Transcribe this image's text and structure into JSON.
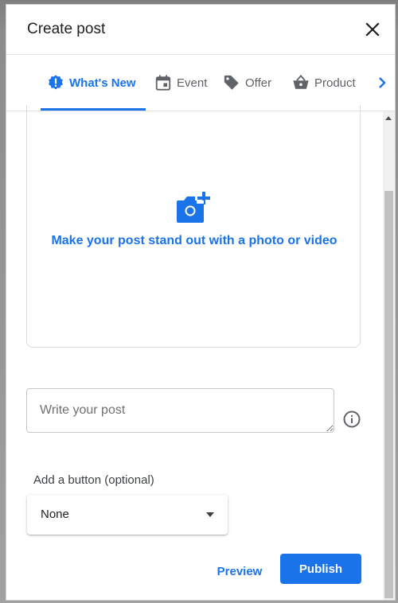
{
  "dialog": {
    "title": "Create post",
    "close_icon": "close-icon"
  },
  "tabs": [
    {
      "label": "What's New",
      "icon": "exclamation-badge-icon",
      "active": true
    },
    {
      "label": "Event",
      "icon": "calendar-icon",
      "active": false
    },
    {
      "label": "Offer",
      "icon": "tag-icon",
      "active": false
    },
    {
      "label": "Product",
      "icon": "basket-icon",
      "active": false
    }
  ],
  "tabs_next_icon": "chevron-right-icon",
  "media": {
    "icon": "add-photo-icon",
    "text": "Make your post stand out with a photo or video"
  },
  "post": {
    "placeholder": "Write your post",
    "value": "",
    "info_icon": "info-icon"
  },
  "cta": {
    "label": "Add a button (optional)",
    "selected": "None",
    "caret_icon": "dropdown-caret-icon"
  },
  "actions": {
    "preview": "Preview",
    "publish": "Publish"
  },
  "colors": {
    "accent": "#1a73e8",
    "text": "#202124",
    "muted": "#5f6368"
  }
}
